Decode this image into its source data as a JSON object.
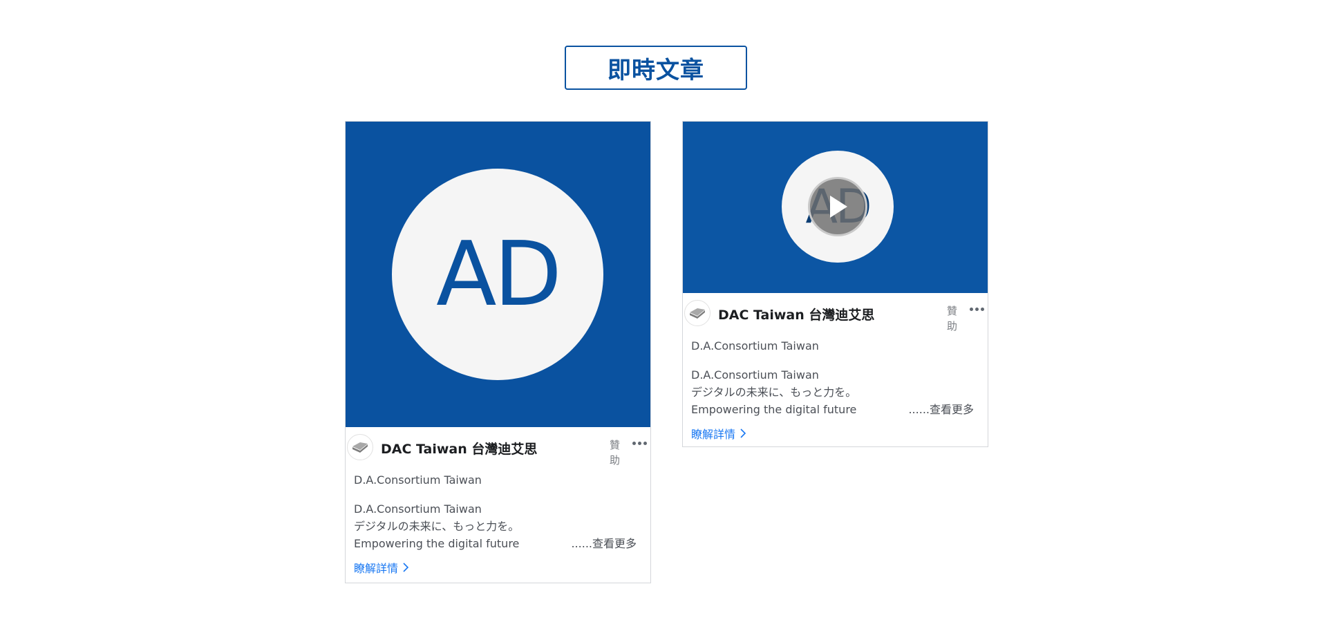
{
  "section_tab": {
    "label": "即時文章"
  },
  "colors": {
    "brand_blue": "#0a52a0",
    "link_blue": "#1877f2"
  },
  "cards": [
    {
      "media_type": "image",
      "ad_logo_text": "AD",
      "page_name": "DAC Taiwan 台灣迪艾思",
      "sponsored_label": "贊助",
      "subtitle": "D.A.Consortium Taiwan",
      "desc_lines": [
        "D.A.Consortium Taiwan",
        "デジタルの未来に、もっと力を。",
        "Empowering the digital future"
      ],
      "see_more": "......查看更多",
      "learn_more": "瞭解詳情"
    },
    {
      "media_type": "video",
      "ad_logo_text": "AD",
      "page_name": "DAC Taiwan 台灣迪艾思",
      "sponsored_label": "贊助",
      "subtitle": "D.A.Consortium Taiwan",
      "desc_lines": [
        "D.A.Consortium Taiwan",
        "デジタルの未来に、もっと力を。",
        "Empowering the digital future"
      ],
      "see_more": "......查看更多",
      "learn_more": "瞭解詳情"
    }
  ]
}
